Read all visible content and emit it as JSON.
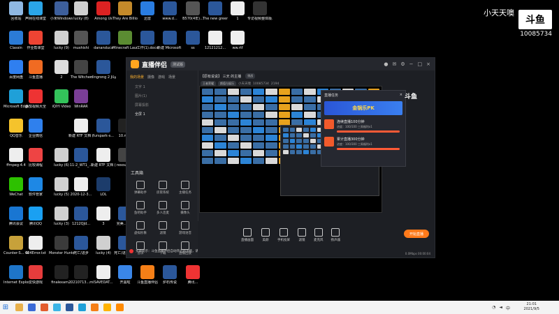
{
  "desktop": {
    "icons": [
      {
        "label": "回收站",
        "color": "#8fb8e3"
      },
      {
        "label": "声网在线课堂",
        "color": "#2aa5e8"
      },
      {
        "label": "小米Windows",
        "color": "#3d5f9c"
      },
      {
        "label": "lucky (8)",
        "color": "#d0d0d0"
      },
      {
        "label": "Among Us",
        "color": "#d22"
      },
      {
        "label": "They Are Billions",
        "color": "#c48a2a"
      },
      {
        "label": "迅雷",
        "color": "#2a7de1"
      },
      {
        "label": "www.d...",
        "color": "#2b579a"
      },
      {
        "label": "B570(4年)...",
        "color": "#555"
      },
      {
        "label": "The new green rev...",
        "color": "#2b579a"
      },
      {
        "label": "1",
        "color": "#eee"
      },
      {
        "label": "专访视频整体版.mp4",
        "color": "#333"
      },
      {
        "label": "Classin",
        "color": "#2b7bd6"
      },
      {
        "label": "作业帮课堂",
        "color": "#e43"
      },
      {
        "label": "lucky (9)",
        "color": "#d0d0d0"
      },
      {
        "label": "mushishi",
        "color": "#555"
      },
      {
        "label": "dananducx",
        "color": "#2b579a"
      },
      {
        "label": "Minecraft Launcher",
        "color": "#5b8c32"
      },
      {
        "label": "工作(1).docx",
        "color": "#2b579a"
      },
      {
        "label": "新建 Microsoft ...",
        "color": "#2b579a"
      },
      {
        "label": "ss",
        "color": "#2b579a"
      },
      {
        "label": "12121212...",
        "color": "#eee"
      },
      {
        "label": "ww.rtf",
        "color": "#eee"
      },
      {
        "label": "百度网盘",
        "color": "#2f7ff0"
      },
      {
        "label": "斗鱼直播",
        "color": "#f06b22"
      },
      {
        "label": "2",
        "color": "#ddd"
      },
      {
        "label": "The Witcher",
        "color": "#444"
      },
      {
        "label": "dingrong 2 JiLyuanj...",
        "color": "#2b579a"
      },
      {
        "label": "Microsoft Edge",
        "color": "#1fa0d8"
      },
      {
        "label": "番茄视频大全",
        "color": "#e33"
      },
      {
        "label": "iQIYI Video",
        "color": "#33c35a"
      },
      {
        "label": "WinRAR",
        "color": "#7a3e96"
      },
      {
        "label": "QQ音乐",
        "color": "#f5c32c"
      },
      {
        "label": "企业微信",
        "color": "#2f80ed"
      },
      {
        "label": "新建 RTF 文档 (2).rtf",
        "color": "#eee"
      },
      {
        "label": "furspark-s...",
        "color": "#2b579a"
      },
      {
        "label": "10.mkv",
        "color": "#222"
      },
      {
        "label": "ffmpeg-4.4",
        "color": "#eee"
      },
      {
        "label": "比较课程",
        "color": "#e44"
      },
      {
        "label": "lucky (6)",
        "color": "#d0d0d0"
      },
      {
        "label": "11-2_WT1_...",
        "color": "#2b579a"
      },
      {
        "label": "新建 RTF 文档 (3).rtf",
        "color": "#eee"
      },
      {
        "label": "resources",
        "color": "#444"
      },
      {
        "label": "WeChat",
        "color": "#2dc100"
      },
      {
        "label": "软件管家",
        "color": "#1e88e5"
      },
      {
        "label": "lucky (5)",
        "color": "#d0d0d0"
      },
      {
        "label": "2020-12-3...",
        "color": "#eee"
      },
      {
        "label": "LOL",
        "color": "#1c3c6b"
      },
      {
        "label": "腾讯会议",
        "color": "#1976d2"
      },
      {
        "label": "腾讯QQ",
        "color": "#1aa0f2"
      },
      {
        "label": "lucky (3)",
        "color": "#d0d0d0"
      },
      {
        "label": "1212QJd...",
        "color": "#2b579a"
      },
      {
        "label": "3",
        "color": "#eee"
      },
      {
        "label": "完美...文...",
        "color": "#2b579a"
      },
      {
        "label": "Counter-S... Global Off...",
        "color": "#c7a13a"
      },
      {
        "label": "404Error.txt",
        "color": "#eee"
      },
      {
        "label": "Monster Hunter...",
        "color": "#3b3b3b"
      },
      {
        "label": "死亡/进步",
        "color": "#2b579a"
      },
      {
        "label": "lucky (4)",
        "color": "#d0d0d0"
      },
      {
        "label": "死亡/进步文件",
        "color": "#2b579a"
      },
      {
        "label": "Internet Explorer",
        "color": "#1e75c9"
      },
      {
        "label": "爱快游戏",
        "color": "#e63c3c"
      },
      {
        "label": "finalexam...",
        "color": "#222"
      },
      {
        "label": "20210713...mkv",
        "color": "#222"
      },
      {
        "label": "SAVEDAT...",
        "color": "#eee"
      },
      {
        "label": "开黑啦",
        "color": "#3a86e8"
      },
      {
        "label": "斗鱼直播伴侣",
        "color": "#f57f17"
      },
      {
        "label": "炉石传说",
        "color": "#2b579a"
      },
      {
        "label": "腾讯...",
        "color": "#e33"
      }
    ]
  },
  "watermark": {
    "name": "小天天噢",
    "logo": "斗鱼",
    "room_id": "10085734"
  },
  "app": {
    "title": "直播伴侣",
    "beta": "测试版",
    "window_controls": [
      "−",
      "□",
      "×"
    ],
    "scene_tabs": [
      "我的场景",
      "摄像",
      "游戏",
      "场景"
    ],
    "sources": [
      "文字 1",
      "图片(1)",
      "屏幕投影",
      "全屏 1"
    ],
    "tools_header": "工具箱",
    "tools": [
      "弹幕助手",
      "房管系统",
      "主播任务",
      "鱼吧助手",
      "多人连麦",
      "摄像头",
      "虚拟形象",
      "滤镜",
      "游戏语音",
      "音乐",
      "下载",
      "直播回放"
    ],
    "notice": "文章提示：斗鱼直播伴侣自动开启新功能，请及时查看",
    "room_title": "【原有说说】 三天 的主播",
    "room_tag": "挑战",
    "category_pills": [
      "王者荣耀",
      "颜值与娱乐"
    ],
    "room_id_label": "小天天噢",
    "room_id": "10085734",
    "hot": "2194",
    "popup": {
      "title": "直播任务",
      "banner": "金锅乐PK",
      "tasks": [
        {
          "title": "连续直播100分钟",
          "sub": "进度：100/100 三周福利x1",
          "progress": 1.0
        },
        {
          "title": "累计直播300分钟",
          "sub": "进度：100/300 三周福利x1",
          "progress": 1.0
        }
      ]
    },
    "side_logo": "斗鱼",
    "bottom_tools": [
      "直播画面",
      "美颜",
      "手机投屏",
      "滤镜",
      "麦克风",
      "扬声器"
    ],
    "live_button": "开始直播",
    "status": "0.0Mbps  00:00:04"
  },
  "taskbar": {
    "clock_time": "21:01",
    "clock_date": "2021/9/5",
    "icon_colors": [
      "#e8b04a",
      "#3b6ad6",
      "#e35d2e",
      "#3cb5e6",
      "#2b579a",
      "#1fa0d8",
      "#f57f17",
      "#ffb300",
      "#ff8a00"
    ]
  }
}
